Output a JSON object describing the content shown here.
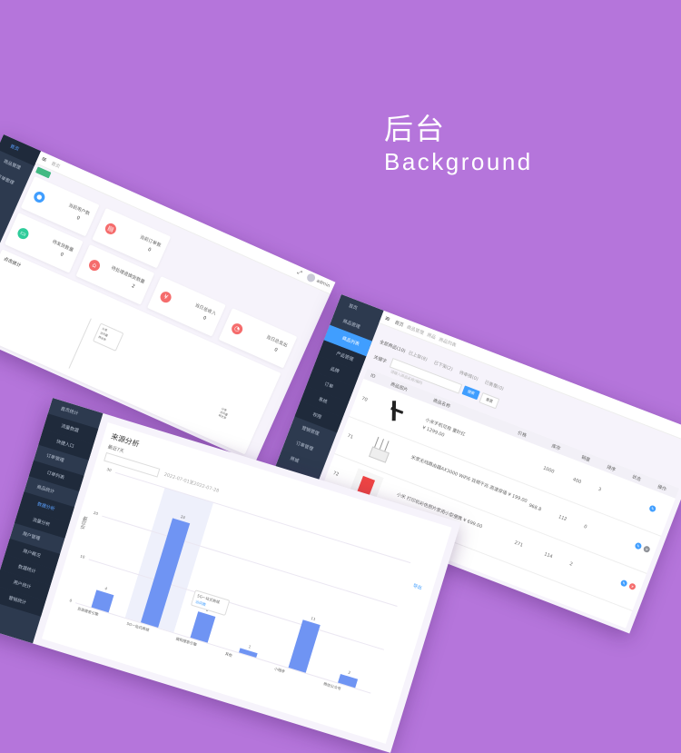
{
  "hero": {
    "title": "后台",
    "subtitle": "Background"
  },
  "dashboard": {
    "sidebar": [
      "首页",
      "商品管理",
      "订单管理",
      "设置"
    ],
    "breadcrumb": "首页",
    "tag": "首页",
    "cards": [
      {
        "label": "当前用户数",
        "value": "0",
        "icon": "user-icon",
        "color": "#409eff"
      },
      {
        "label": "当前订单数",
        "value": "0",
        "icon": "order-icon",
        "color": "#f56c6c"
      },
      {
        "label": "待发货数量",
        "value": "0",
        "icon": "truck-icon",
        "color": "#2ecc9a"
      },
      {
        "label": "待处理退换货数量",
        "value": "2",
        "icon": "shop-icon",
        "color": "#f56c6c"
      },
      {
        "label": "当日总收入",
        "value": "0",
        "icon": "yen-icon",
        "color": "#f56c6c"
      },
      {
        "label": "当日总支出",
        "value": "0",
        "icon": "chart-icon",
        "color": "#f56c6c"
      }
    ],
    "section_title": "点击统计",
    "legend": [
      "分享",
      "访问量",
      "转化率"
    ],
    "tooltip": [
      "分享",
      "访问量",
      "转化率"
    ],
    "user": "admin"
  },
  "products": {
    "sidebar": [
      "首页",
      "商品管理",
      "商品列表",
      "产品管理",
      "品牌",
      "订单",
      "系统",
      "权限",
      "营销管理",
      "订单管理",
      "商城"
    ],
    "breadcrumb": [
      "首页",
      "商品管理",
      "商品",
      "商品列表"
    ],
    "tabs": [
      "全部商品(10)",
      "已上架(8)",
      "已下架(2)",
      "待审核(0)",
      "已售罄(0)"
    ],
    "filter_label": "关键字",
    "filter_placeholder": "请输入商品名称/编码",
    "search_btn": "搜索",
    "reset_btn": "重置",
    "columns": [
      "ID",
      "商品图片",
      "商品名称",
      "价格",
      "库存",
      "销量",
      "排序",
      "状态",
      "操作"
    ],
    "rows": [
      {
        "id": "70",
        "name": "小米手机可用 重针红",
        "price": "¥ 1299.00",
        "stock": "1000",
        "sales": "400",
        "sort": "3"
      },
      {
        "id": "71",
        "name": "米家无线路由器AX3000 WiFi6 双频千兆 高速穿墙 ¥ 199.00",
        "price": "¥ 199.00",
        "stock": "968.8",
        "sales": "112",
        "sort": "0"
      },
      {
        "id": "72",
        "name": "小米 打印机彩色照片家用小型便携 ¥ 699.00",
        "price": "¥ 699.00",
        "stock": "271",
        "sales": "114",
        "sort": "2"
      }
    ]
  },
  "analytics": {
    "sidebar": [
      "首页统计",
      "流量数据",
      "快捷入口",
      "订单管理",
      "订单列表",
      "商品统计",
      "数据分析",
      "流量分析",
      "用户管理",
      "用户概况",
      "数据统计",
      "用户统计",
      "营销统计"
    ],
    "title": "来源分析",
    "range": "最近7天",
    "dates": "2022-07-01至2022-07-28",
    "export_btn": "导出",
    "tooltip_title": "5G一站式商城",
    "tooltip_series": "访问数",
    "chart_data": {
      "type": "bar",
      "categories": [
        "百度搜索引擎",
        "5G一站式商城",
        "搜狗搜索引擎",
        "其他",
        "小程序",
        "微信公众号"
      ],
      "values": [
        4,
        24,
        6,
        1,
        11,
        2
      ],
      "ylabel": "访问数",
      "yticks": [
        "30",
        "20",
        "10",
        "0"
      ]
    }
  }
}
